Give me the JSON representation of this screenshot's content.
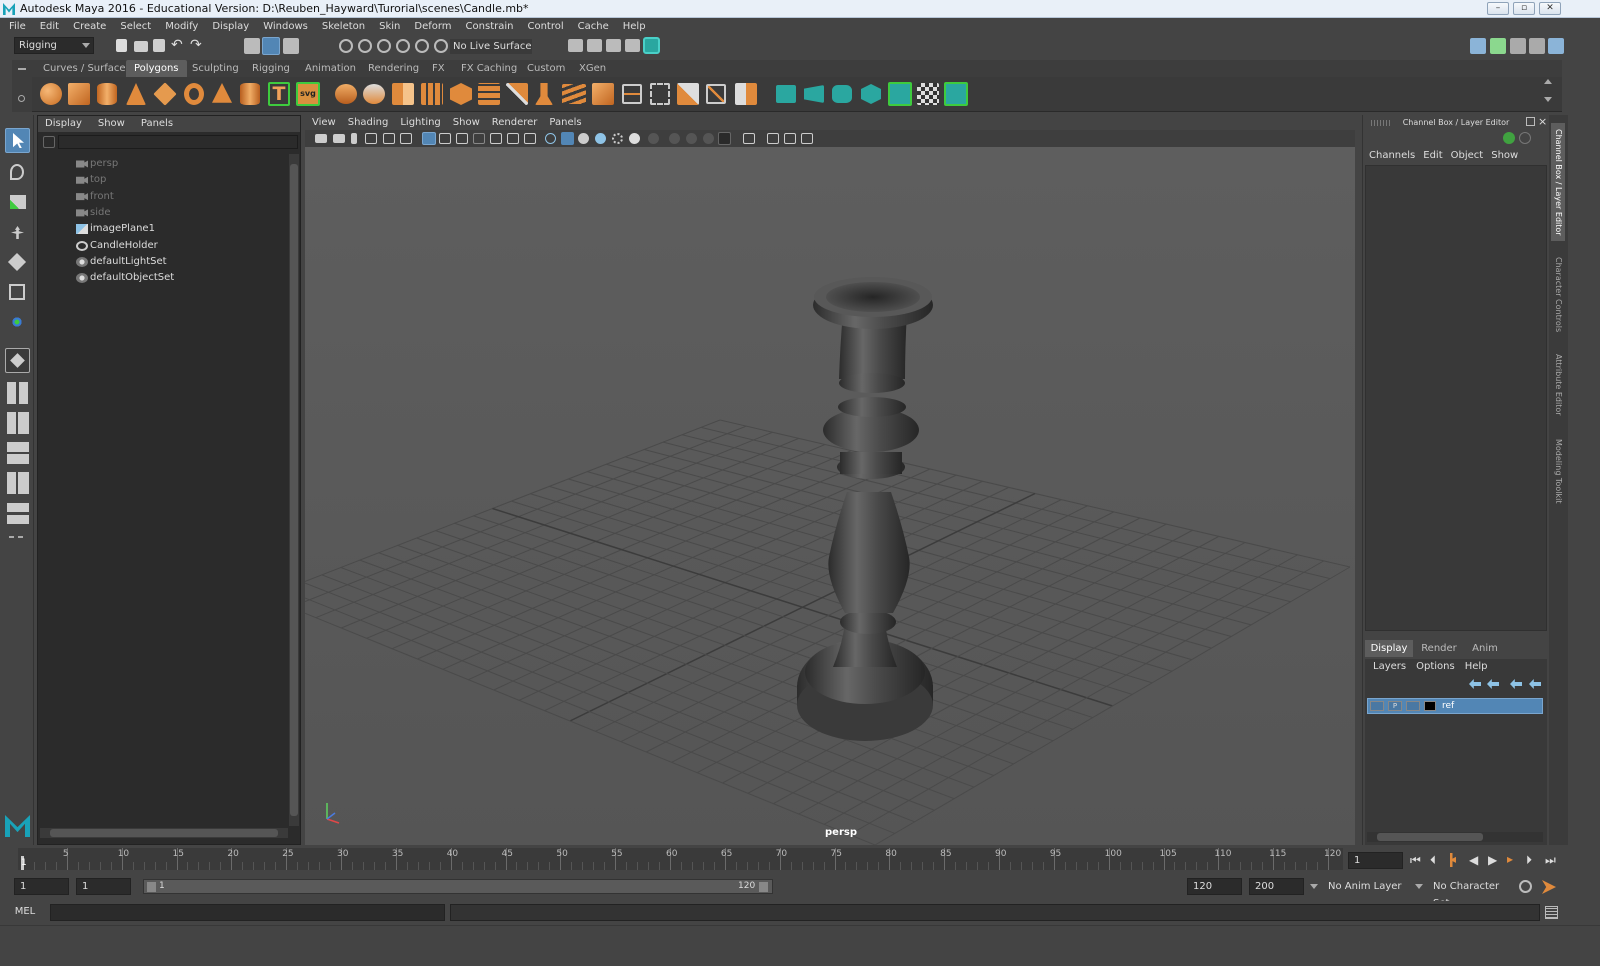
{
  "window": {
    "title": "Autodesk Maya 2016 - Educational Version: D:\\Reuben_Hayward\\Turorial\\scenes\\Candle.mb*"
  },
  "menubar": [
    "File",
    "Edit",
    "Create",
    "Select",
    "Modify",
    "Display",
    "Windows",
    "Skeleton",
    "Skin",
    "Deform",
    "Constrain",
    "Control",
    "Cache",
    "Help"
  ],
  "statusline": {
    "mode": "Rigging",
    "live_surface": "No Live Surface"
  },
  "shelf": {
    "tabs": [
      "Curves / Surfaces",
      "Polygons",
      "Sculpting",
      "Rigging",
      "Animation",
      "Rendering",
      "FX",
      "FX Caching",
      "Custom",
      "XGen"
    ],
    "active": "Polygons"
  },
  "outliner": {
    "menu": [
      "Display",
      "Show",
      "Panels"
    ],
    "items": [
      {
        "label": "persp",
        "icon": "camera-icon",
        "dim": true
      },
      {
        "label": "top",
        "icon": "camera-icon",
        "dim": true
      },
      {
        "label": "front",
        "icon": "camera-icon",
        "dim": true
      },
      {
        "label": "side",
        "icon": "camera-icon",
        "dim": true
      },
      {
        "label": "imagePlane1",
        "icon": "image-plane-icon",
        "dim": false
      },
      {
        "label": "CandleHolder",
        "icon": "transform-icon",
        "dim": false
      },
      {
        "label": "defaultLightSet",
        "icon": "set-icon",
        "dim": false
      },
      {
        "label": "defaultObjectSet",
        "icon": "set-icon",
        "dim": false
      }
    ]
  },
  "viewport": {
    "menu": [
      "View",
      "Shading",
      "Lighting",
      "Show",
      "Renderer",
      "Panels"
    ],
    "camera_label": "persp"
  },
  "channel_box": {
    "title": "Channel Box / Layer Editor",
    "menu": [
      "Channels",
      "Edit",
      "Object",
      "Show"
    ],
    "layer_tabs": [
      "Display",
      "Render",
      "Anim"
    ],
    "active_layer_tab": "Display",
    "layer_menu": [
      "Layers",
      "Options",
      "Help"
    ],
    "layer": {
      "visible": "",
      "type": "P",
      "name": "ref",
      "color": "#000000"
    }
  },
  "side_tabs": [
    "Channel Box / Layer Editor",
    "Character Controls",
    "Attribute Editor",
    "Modeling Toolkit"
  ],
  "timeline": {
    "ticks": [
      "5",
      "10",
      "15",
      "20",
      "25",
      "30",
      "35",
      "40",
      "45",
      "50",
      "55",
      "60",
      "65",
      "70",
      "75",
      "80",
      "85",
      "90",
      "95",
      "100",
      "105",
      "110",
      "115",
      "120"
    ],
    "current_marker": "1",
    "current_frame": "1"
  },
  "range": {
    "start": "1",
    "playback_start": "1",
    "slider_start": "1",
    "slider_end": "120",
    "playback_end": "120",
    "end": "200",
    "anim_layer": "No Anim Layer",
    "character_set": "No Character Set"
  },
  "command": {
    "label": "MEL"
  }
}
